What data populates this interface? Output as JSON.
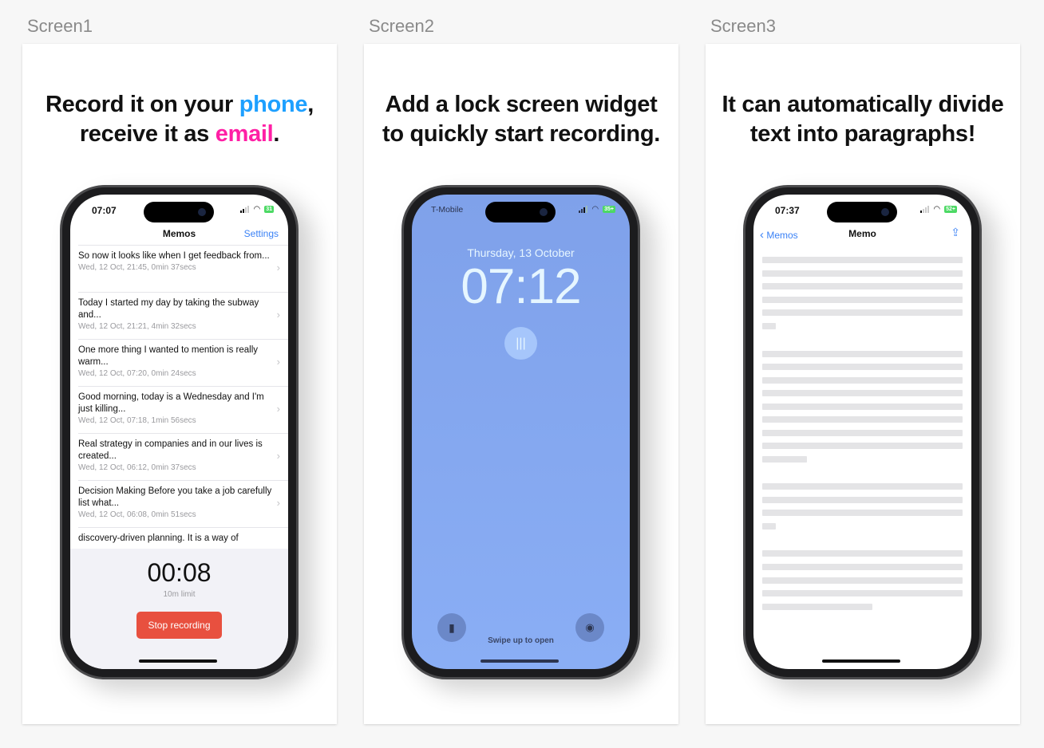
{
  "screens": [
    {
      "label": "Screen1",
      "headline_a": "Record it on your ",
      "headline_phone": "phone",
      "headline_b": ",",
      "headline_c": "receive it as ",
      "headline_email": "email",
      "headline_d": "."
    },
    {
      "label": "Screen2",
      "headline_line1": "Add a lock screen widget",
      "headline_line2": "to quickly start recording."
    },
    {
      "label": "Screen3",
      "headline_line1": "It can automatically divide",
      "headline_line2": "text into paragraphs!"
    }
  ],
  "colors": {
    "phone_word": "#1ea0ff",
    "email_word": "#ff1fa5",
    "lockscreen_bg": "#86a8f0",
    "stop_button": "#e8503f",
    "link": "#3b82f6"
  },
  "memos_app": {
    "status": {
      "time": "07:07",
      "battery": "31"
    },
    "nav_title": "Memos",
    "settings": "Settings",
    "items": [
      {
        "title": "So now it looks like when I get feedback from...",
        "meta": "Wed, 12 Oct, 21:45, 0min 37secs"
      },
      {
        "title": "Today I started my day by taking the subway and...",
        "meta": "Wed, 12 Oct, 21:21, 4min 32secs"
      },
      {
        "title": "One more thing I wanted to mention is really warm...",
        "meta": "Wed, 12 Oct, 07:20, 0min 24secs"
      },
      {
        "title": "Good morning, today is a Wednesday and I'm just killing...",
        "meta": "Wed, 12 Oct, 07:18, 1min 56secs"
      },
      {
        "title": "Real strategy in companies and in our lives is created...",
        "meta": "Wed, 12 Oct, 06:12, 0min 37secs"
      },
      {
        "title": "Decision Making Before you take a job carefully list what...",
        "meta": "Wed, 12 Oct, 06:08, 0min 51secs"
      },
      {
        "title": "discovery-driven planning. It is a way of",
        "meta": ""
      }
    ],
    "timer": "00:08",
    "limit": "10m limit",
    "stop": "Stop recording"
  },
  "lock_screen": {
    "carrier": "T-Mobile",
    "battery": "35+",
    "date": "Thursday, 13 October",
    "time": "07:12",
    "widget_icon": "waveform-icon",
    "swipe": "Swipe up to open"
  },
  "memo_detail": {
    "status": {
      "time": "07:37",
      "battery": "52+"
    },
    "back": "Memos",
    "title": "Memo",
    "share_icon": "share-icon"
  }
}
